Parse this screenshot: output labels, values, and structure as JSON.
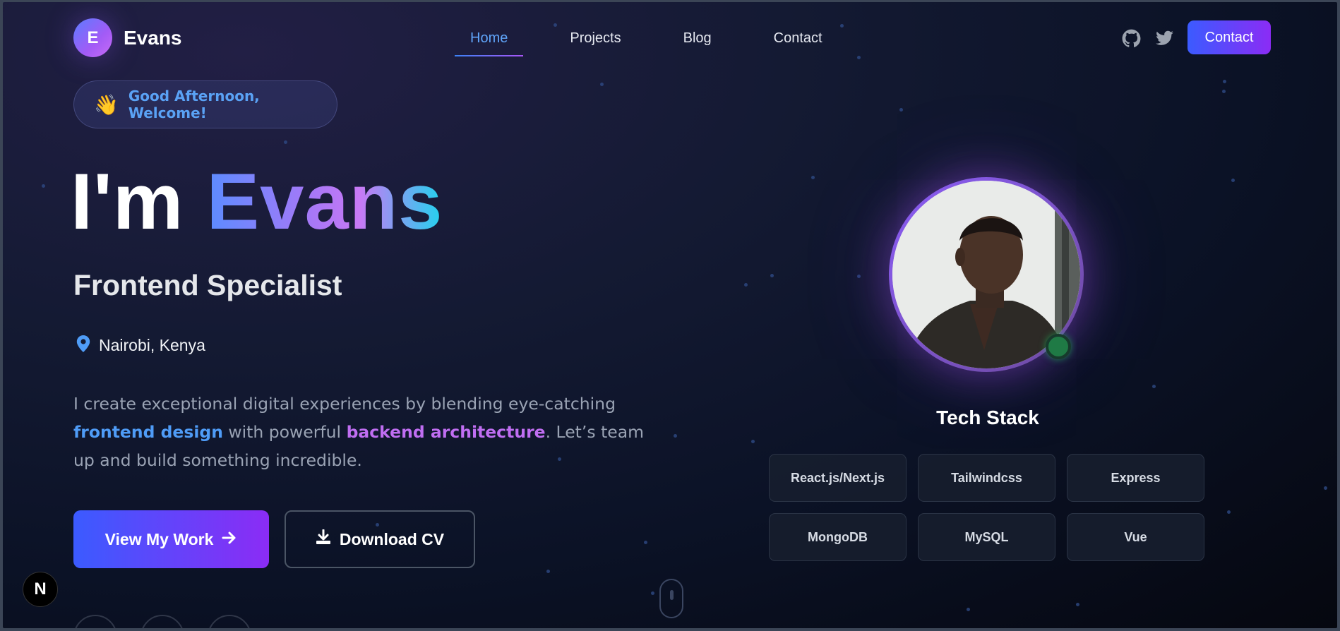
{
  "brand": {
    "logo_letter": "E",
    "name": "Evans"
  },
  "nav": {
    "items": [
      {
        "label": "Home",
        "active": true
      },
      {
        "label": "Projects",
        "active": false
      },
      {
        "label": "Blog",
        "active": false
      },
      {
        "label": "Contact",
        "active": false
      }
    ],
    "socials": [
      "github-icon",
      "twitter-icon"
    ],
    "contact_button": "Contact"
  },
  "hero": {
    "greeting_emoji": "👋",
    "greeting": "Good Afternoon, Welcome!",
    "prefix": "I'm ",
    "name": "Evans",
    "role": "Frontend Specialist",
    "location": "Nairobi, Kenya",
    "bio": {
      "part1": "I create exceptional digital experiences by blending eye-catching ",
      "highlight1": "frontend design",
      "part2": " with powerful ",
      "highlight2": "backend architecture",
      "part3": ". Let’s team up and build something incredible."
    },
    "primary_button": "View My Work",
    "secondary_button": "Download CV"
  },
  "profile": {
    "status": "online"
  },
  "tech_stack": {
    "title": "Tech Stack",
    "items": [
      "React.js/Next.js",
      "Tailwindcss",
      "Express",
      "MongoDB",
      "MySQL",
      "Vue"
    ]
  },
  "dev_badge": "N",
  "colors": {
    "accent_blue": "#60a5fa",
    "accent_purple": "#a855f7",
    "button_gradient_start": "#3b5bff",
    "button_gradient_end": "#8b2cf5",
    "online_green": "#22c55e"
  }
}
